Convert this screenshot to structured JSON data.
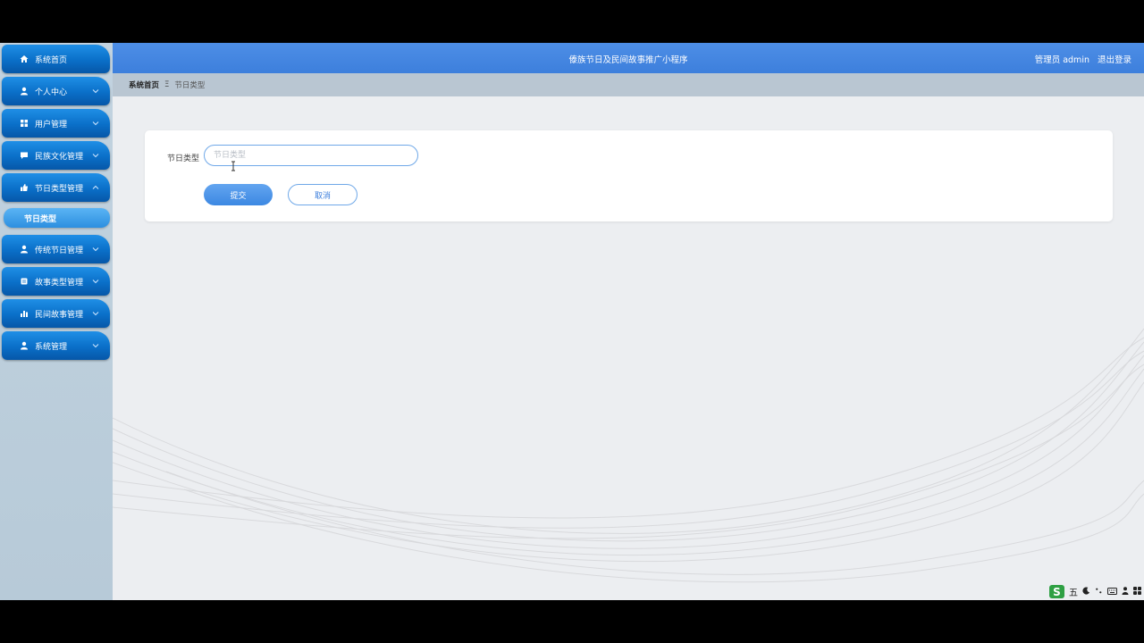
{
  "app": {
    "title": "傣族节日及民间故事推广小程序",
    "user_label": "管理员 admin",
    "logout": "退出登录"
  },
  "colors": {
    "header": "#3d7fdc",
    "sidebar_item": "#0a6fc8",
    "sub_item": "#2d8fe0",
    "sidebar_bg": "#c2d3e0"
  },
  "sidebar": {
    "items": [
      {
        "label": "系统首页",
        "icon": "home-icon",
        "expandable": false
      },
      {
        "label": "个人中心",
        "icon": "person-icon",
        "expandable": true
      },
      {
        "label": "用户管理",
        "icon": "grid-icon",
        "expandable": true
      },
      {
        "label": "民族文化管理",
        "icon": "chat-icon",
        "expandable": true
      },
      {
        "label": "节日类型管理",
        "icon": "thumbs-up-icon",
        "expandable": true,
        "expanded": true
      },
      {
        "label": "传统节日管理",
        "icon": "person-icon",
        "expandable": true
      },
      {
        "label": "故事类型管理",
        "icon": "doc-icon",
        "expandable": true
      },
      {
        "label": "民间故事管理",
        "icon": "bar-chart-icon",
        "expandable": true
      },
      {
        "label": "系统管理",
        "icon": "person-icon",
        "expandable": true
      }
    ],
    "sub_item": "节日类型"
  },
  "breadcrumb": {
    "home": "系统首页",
    "separator": "Ξ",
    "current": "节日类型"
  },
  "form": {
    "field_label": "节日类型",
    "field_placeholder": "节日类型",
    "field_value": "",
    "submit": "提交",
    "cancel": "取消"
  },
  "tray": {
    "ime": "五"
  }
}
